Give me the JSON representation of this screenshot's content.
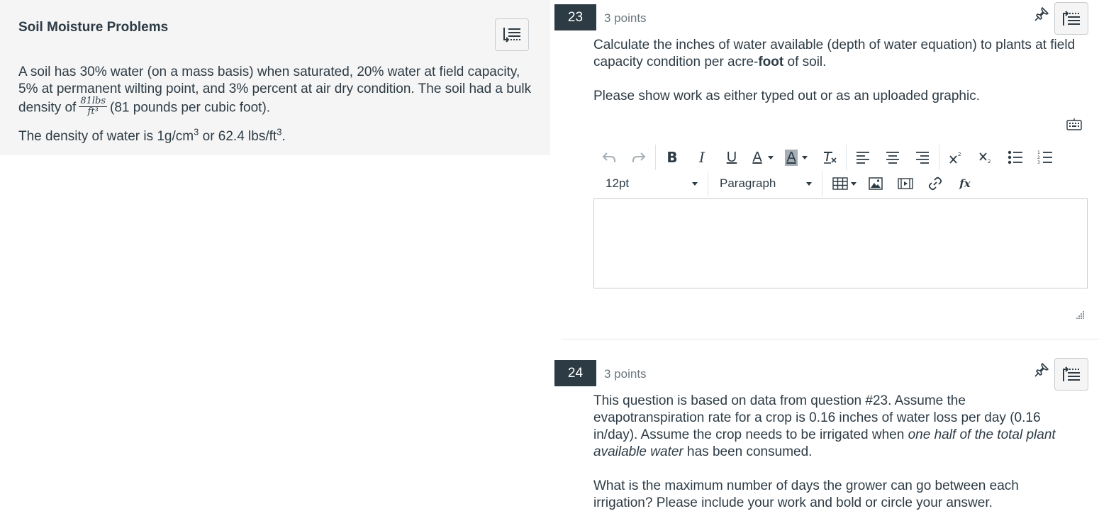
{
  "stimulus": {
    "title": "Soil Moisture Problems",
    "para1_a": "A soil has 30% water (on a mass basis) when saturated, 20% water at field capacity, 5% at permanent wilting point, and 3% percent at air dry condition. The soil had a bulk density of",
    "frac_num": "81lbs",
    "frac_den": "ft³",
    "para1_b": "(81 pounds per cubic foot).",
    "para2_a": "The density of water is 1g/cm",
    "para2_sup1": "3",
    "para2_b": " or 62.4 lbs/ft",
    "para2_sup2": "3",
    "para2_c": "."
  },
  "questions": [
    {
      "number": "23",
      "points": "3 points",
      "text1_a": "Calculate the inches of water available (depth of water equation) to plants at field capacity condition per acre-",
      "text1_bold": "foot",
      "text1_b": " of soil.",
      "text2": "Please show work as either typed out or as an uploaded graphic."
    },
    {
      "number": "24",
      "points": "3 points",
      "text1_a": "This question is based on data from question #23. Assume the evapotranspiration rate for a crop is 0.16 inches of water loss per day (0.16 in/day). Assume the crop needs to be irrigated when ",
      "text1_italic": "one half of the total plant available water",
      "text1_b": " has been consumed.",
      "text2": "What is the maximum number of days the grower can go between each irrigation? Please include your work and bold or circle your answer."
    }
  ],
  "editor": {
    "font_size": "12pt",
    "block_format": "Paragraph",
    "bold_glyph": "B",
    "italic_glyph": "I",
    "underline_glyph": "U",
    "text_color_glyph": "A",
    "highlight_glyph": "A",
    "function_glyph": "fx"
  },
  "icons": [
    "collapse-list-icon",
    "pin-icon",
    "keyboard-icon",
    "undo-icon",
    "redo-icon",
    "table-icon",
    "image-icon",
    "media-icon",
    "link-icon",
    "resize-handle-icon"
  ],
  "colors": {
    "question_badge": "#2d3b45",
    "stimulus_bg": "#f5f5f5",
    "text": "#2d3b45",
    "muted": "#6b7780"
  }
}
